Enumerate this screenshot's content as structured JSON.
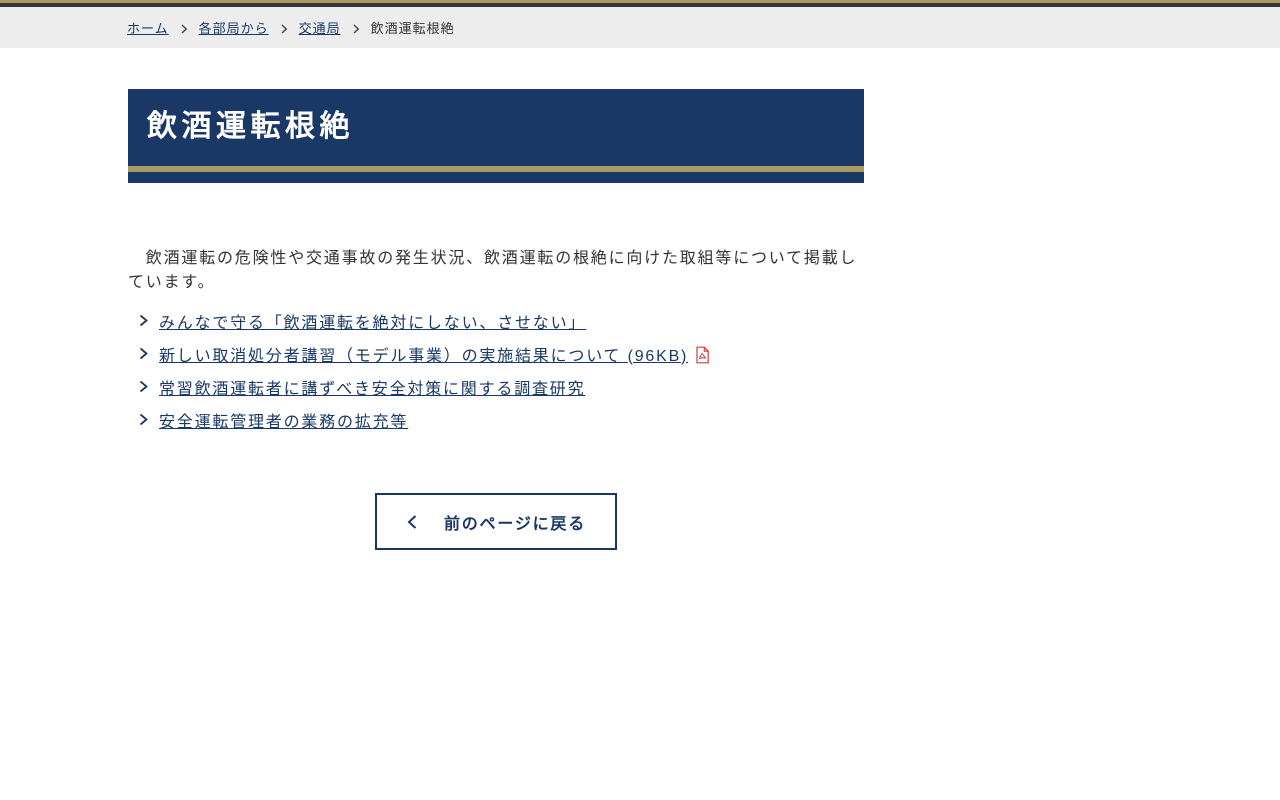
{
  "colors": {
    "navy": "#1a3866",
    "gold": "#a89a63",
    "top_bar_dark": "#363636",
    "breadcrumb_bg": "#ededed",
    "body_text": "#333333",
    "pdf_red": "#c94040"
  },
  "breadcrumb": {
    "items": [
      {
        "label": "ホーム",
        "link": true
      },
      {
        "label": "各部局から",
        "link": true
      },
      {
        "label": "交通局",
        "link": true
      },
      {
        "label": "飲酒運転根絶",
        "link": false
      }
    ],
    "separator_icon": "chevron-right"
  },
  "banner": {
    "title": "飲酒運転根絶"
  },
  "intro": {
    "text": "　飲酒運転の危険性や交通事故の発生状況、飲酒運転の根絶に向けた取組等について掲載しています。"
  },
  "links": [
    {
      "label": "みんなで守る「飲酒運転を絶対にしない、させない」",
      "pdf": false
    },
    {
      "label": "新しい取消処分者講習（モデル事業）の実施結果について (96KB)",
      "pdf": true,
      "pdf_icon": "pdf-file"
    },
    {
      "label": "常習飲酒運転者に講ずべき安全対策に関する調査研究",
      "pdf": false
    },
    {
      "label": "安全運転管理者の業務の拡充等",
      "pdf": false
    }
  ],
  "back_button": {
    "label": "前のページに戻る",
    "icon": "chevron-left"
  }
}
